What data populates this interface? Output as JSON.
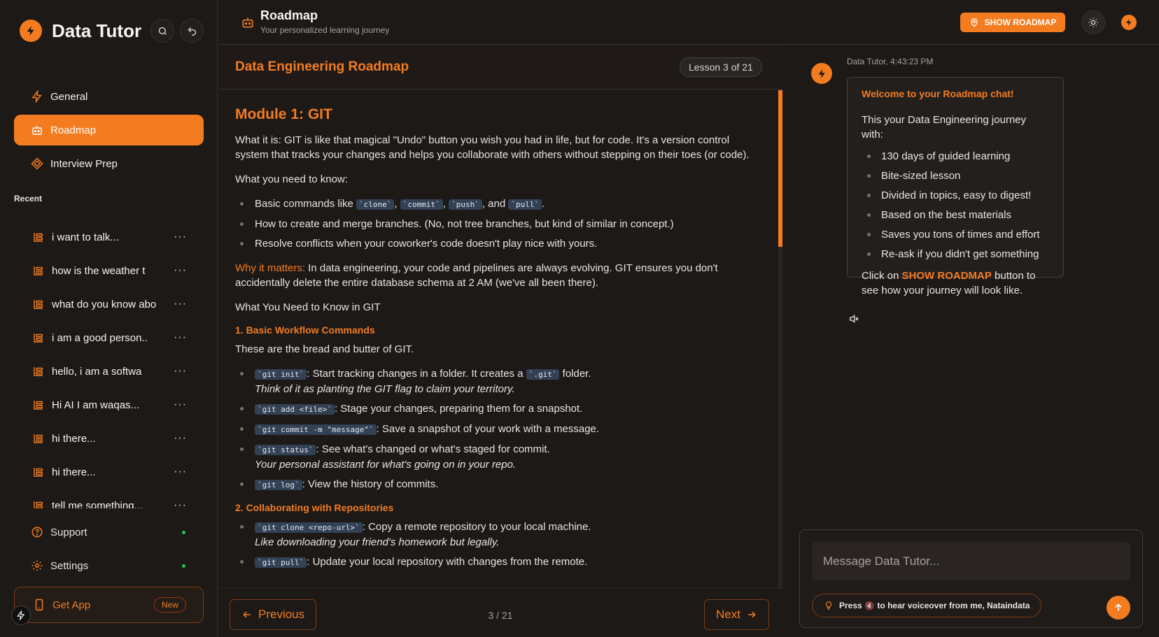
{
  "app": {
    "name": "Data Tutor"
  },
  "sidebar": {
    "nav": [
      {
        "label": "General",
        "icon": "bolt-icon"
      },
      {
        "label": "Roadmap",
        "icon": "robot-icon",
        "active": true
      },
      {
        "label": "Interview Prep",
        "icon": "diamond-icon"
      }
    ],
    "recent_title": "Recent",
    "recent": [
      "i want to talk...",
      "how is the weather t",
      "what do you know abo",
      "i am a good person..",
      "hello, i am a softwa",
      "Hi AI I am waqas...",
      "hi there...",
      "hi there...",
      "tell me something..."
    ],
    "more_label": "···",
    "support": "Support",
    "settings": "Settings",
    "get_app": "Get App",
    "new_badge": "New"
  },
  "header": {
    "title": "Roadmap",
    "subtitle": "Your personalized learning journey",
    "show_roadmap": "SHOW ROADMAP"
  },
  "lesson": {
    "title": "Data Engineering Roadmap",
    "badge": "Lesson 3 of 21",
    "module_title": "Module 1: GIT",
    "intro": "What it is: GIT is like that magical \"Undo\" button you wish you had in life, but for code. It's a version control system that tracks your changes and helps you collaborate with others without stepping on their toes (or code).",
    "need_to_know": "What you need to know:",
    "bullets": {
      "b1_pre": "Basic commands like ",
      "b1_c1": "`clone`",
      "b1_c2": "`commit`",
      "b1_c3": "`push`",
      "b1_and": ", and ",
      "b1_c4": "`pull`",
      "b2": "How to create and merge branches. (No, not tree branches, but kind of similar in concept.)",
      "b3": "Resolve conflicts when your coworker's code doesn't play nice with yours."
    },
    "why_label": "Why it matters:",
    "why_text": " In data engineering, your code and pipelines are always evolving. GIT ensures you don't accidentally delete the entire database schema at 2 AM (we've all been there).",
    "need_git": "What You Need to Know in GIT",
    "s1_title": "1. Basic Workflow Commands",
    "s1_intro": "These are the bread and butter of GIT.",
    "s1": {
      "c1": "`git init`",
      "t1a": ": Start tracking changes in a folder. It creates a ",
      "c1b": "`.git`",
      "t1b": " folder.",
      "i1": "Think of it as planting the GIT flag to claim your territory.",
      "c2": "`git add <file>`",
      "t2": ": Stage your changes, preparing them for a snapshot.",
      "c3": "`git commit -m \"message\"`",
      "t3": ": Save a snapshot of your work with a message.",
      "c4": "`git status`",
      "t4": ": See what's changed or what's staged for commit.",
      "i4": "Your personal assistant for what's going on in your repo.",
      "c5": "`git log`",
      "t5": ": View the history of commits."
    },
    "s2_title": "2. Collaborating with Repositories",
    "s2": {
      "c1": "`git clone <repo-url>`",
      "t1": ": Copy a remote repository to your local machine.",
      "i1": "Like downloading your friend's homework but legally.",
      "c2": "`git pull`",
      "t2": ": Update your local repository with changes from the remote."
    },
    "prev": "Previous",
    "next": "Next",
    "page": "3 / 21"
  },
  "chat": {
    "meta": "Data Tutor, 4:43:23 PM",
    "welcome": "Welcome to your Roadmap chat!",
    "intro": "This your Data Engineering journey with:",
    "items": [
      "130 days of guided learning",
      "Bite-sized lesson",
      "Divided in topics, easy to digest!",
      "Based on the best materials",
      "Saves you tons of times and effort",
      "Re-ask if you didn't get something"
    ],
    "outro_pre": "Click on ",
    "outro_link": "SHOW ROADMAP",
    "outro_post": " button to see how your journey will look like.",
    "placeholder": "Message Data Tutor...",
    "hint_pre": "Press ",
    "hint_icon": "🔇",
    "hint_post": " to hear voiceover from me, Nataindata"
  },
  "colors": {
    "accent": "#f47c20",
    "background": "#1c1917",
    "status_dot": "#22c55e"
  }
}
